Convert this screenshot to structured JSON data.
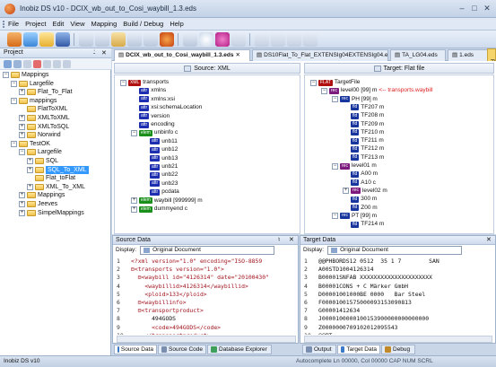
{
  "window": {
    "title": "Inobiz DS v10 - DCIX_wb_out_to_Cosi_waybill_1.3.eds"
  },
  "menu": [
    "File",
    "Project",
    "Edit",
    "View",
    "Mapping",
    "Build / Debug",
    "Help"
  ],
  "project_panel": {
    "title": "Project",
    "close": "✕",
    "pin": "⍘"
  },
  "tree": [
    {
      "depth": 0,
      "label": "Mappings",
      "exp": "−"
    },
    {
      "depth": 1,
      "label": "Largefile",
      "exp": "−"
    },
    {
      "depth": 2,
      "label": "Flat_To_Flat",
      "exp": "+"
    },
    {
      "depth": 1,
      "label": "mappings",
      "exp": "−"
    },
    {
      "depth": 2,
      "label": "FlatToXML",
      "exp": ""
    },
    {
      "depth": 2,
      "label": "XMLToXML",
      "exp": "+"
    },
    {
      "depth": 2,
      "label": "XMLToSQL",
      "exp": "+"
    },
    {
      "depth": 2,
      "label": "Norwind",
      "exp": "+"
    },
    {
      "depth": 1,
      "label": "TestOK",
      "exp": "−"
    },
    {
      "depth": 2,
      "label": "Largefile",
      "exp": "−"
    },
    {
      "depth": 3,
      "label": "SQL",
      "exp": "+"
    },
    {
      "depth": 3,
      "label": "SQL_To_XML",
      "exp": "+",
      "selected": true
    },
    {
      "depth": 3,
      "label": "Flat_toFlat",
      "exp": ""
    },
    {
      "depth": 3,
      "label": "XML_To_XML",
      "exp": "+"
    },
    {
      "depth": 2,
      "label": "Mappings",
      "exp": "+"
    },
    {
      "depth": 2,
      "label": "Jeeves",
      "exp": "+"
    },
    {
      "depth": 2,
      "label": "SimpelMappings",
      "exp": "+"
    }
  ],
  "doc_tabs": [
    {
      "label": "DCIX_wb_out_to_Cosi_waybill_1.3.eds",
      "active": true
    },
    {
      "label": "DS10Flat_To_Flat_EXTENSIg04EXTENSIg04.eds",
      "active": false
    },
    {
      "label": "TA_LG04.eds",
      "active": false
    },
    {
      "label": "1.eds",
      "active": false
    }
  ],
  "source_header": "Source: XML",
  "target_header": "Target: Flat file",
  "source_nodes": [
    {
      "depth": 0,
      "badge": "XML",
      "cls": "b-xml",
      "label": "transports",
      "exp": "−"
    },
    {
      "depth": 1,
      "badge": "attr",
      "cls": "b-attr",
      "label": "xmlns",
      "exp": ""
    },
    {
      "depth": 1,
      "badge": "attr",
      "cls": "b-attr",
      "label": "xmlns:xsi",
      "exp": ""
    },
    {
      "depth": 1,
      "badge": "attr",
      "cls": "b-attr",
      "label": "xsi:schemaLocation",
      "exp": ""
    },
    {
      "depth": 1,
      "badge": "attr",
      "cls": "b-attr",
      "label": "version",
      "exp": ""
    },
    {
      "depth": 1,
      "badge": "attr",
      "cls": "b-attr",
      "label": "encoding",
      "exp": ""
    },
    {
      "depth": 1,
      "badge": "elem",
      "cls": "b-green",
      "label": "unbinfo c",
      "exp": "−"
    },
    {
      "depth": 2,
      "badge": "attr",
      "cls": "b-attr",
      "label": "unb11",
      "exp": ""
    },
    {
      "depth": 2,
      "badge": "attr",
      "cls": "b-attr",
      "label": "unb12",
      "exp": ""
    },
    {
      "depth": 2,
      "badge": "attr",
      "cls": "b-attr",
      "label": "unb13",
      "exp": ""
    },
    {
      "depth": 2,
      "badge": "attr",
      "cls": "b-attr",
      "label": "unb21",
      "exp": ""
    },
    {
      "depth": 2,
      "badge": "attr",
      "cls": "b-attr",
      "label": "unb22",
      "exp": ""
    },
    {
      "depth": 2,
      "badge": "attr",
      "cls": "b-attr",
      "label": "unb23",
      "exp": ""
    },
    {
      "depth": 2,
      "badge": "attr",
      "cls": "b-attr",
      "label": "pcdata",
      "exp": ""
    },
    {
      "depth": 1,
      "badge": "elem",
      "cls": "b-green",
      "label": "waybill [999999] m",
      "exp": "+"
    },
    {
      "depth": 1,
      "badge": "elem",
      "cls": "b-green",
      "label": "dummyend c",
      "exp": "+"
    }
  ],
  "target_nodes": [
    {
      "depth": 0,
      "badge": "FLAT",
      "cls": "b-xml",
      "label": "TargetFile",
      "exp": "−",
      "note": ""
    },
    {
      "depth": 1,
      "badge": "rec",
      "cls": "b-purple",
      "label": "level00 [99] m",
      "exp": "−",
      "note": "<-- transports.waybill"
    },
    {
      "depth": 2,
      "badge": "rec",
      "cls": "b-blue",
      "label": "PH [99] m",
      "exp": "−",
      "note": ""
    },
    {
      "depth": 3,
      "badge": "fld",
      "cls": "b-blue",
      "label": "TF207 m",
      "exp": "",
      "note": ""
    },
    {
      "depth": 3,
      "badge": "fld",
      "cls": "b-blue",
      "label": "TF208 m",
      "exp": "",
      "note": ""
    },
    {
      "depth": 3,
      "badge": "fld",
      "cls": "b-blue",
      "label": "TF209 m",
      "exp": "",
      "note": ""
    },
    {
      "depth": 3,
      "badge": "fld",
      "cls": "b-blue",
      "label": "TF210 m",
      "exp": "",
      "note": ""
    },
    {
      "depth": 3,
      "badge": "fld",
      "cls": "b-blue",
      "label": "TF211 m",
      "exp": "",
      "note": ""
    },
    {
      "depth": 3,
      "badge": "fld",
      "cls": "b-blue",
      "label": "TF212 m",
      "exp": "",
      "note": ""
    },
    {
      "depth": 3,
      "badge": "fld",
      "cls": "b-blue",
      "label": "TF213 m",
      "exp": "",
      "note": ""
    },
    {
      "depth": 2,
      "badge": "rec",
      "cls": "b-purple",
      "label": "level01 m",
      "exp": "−",
      "note": ""
    },
    {
      "depth": 3,
      "badge": "fld",
      "cls": "b-blue",
      "label": "A00 m",
      "exp": "",
      "note": ""
    },
    {
      "depth": 3,
      "badge": "fld",
      "cls": "b-blue",
      "label": "A10 c",
      "exp": "",
      "note": ""
    },
    {
      "depth": 3,
      "badge": "rec",
      "cls": "b-purple",
      "label": "level02 m",
      "exp": "+",
      "note": ""
    },
    {
      "depth": 3,
      "badge": "fld",
      "cls": "b-blue",
      "label": "300 m",
      "exp": "",
      "note": ""
    },
    {
      "depth": 3,
      "badge": "fld",
      "cls": "b-blue",
      "label": "Z00 m",
      "exp": "",
      "note": ""
    },
    {
      "depth": 2,
      "badge": "rec",
      "cls": "b-blue",
      "label": "PT [99] m",
      "exp": "−",
      "note": ""
    },
    {
      "depth": 3,
      "badge": "fld",
      "cls": "b-blue",
      "label": "TF214 m",
      "exp": "",
      "note": ""
    }
  ],
  "source_data": {
    "title": "Source Data",
    "display_label": "Display:",
    "display_value": "Original Document",
    "lines": [
      {
        "n": "1",
        "text": "<?xml version=\"1.0\" encoding=\"ISO-8859"
      },
      {
        "n": "2",
        "text": "⊟<transports version=\"1.0\">"
      },
      {
        "n": "3",
        "text": "  ⊟<waybill id=\"4126314\" date=\"20100430\""
      },
      {
        "n": "4",
        "text": "    <waybillid>4126314</waybillid>"
      },
      {
        "n": "5",
        "text": "    <ploid>133</ploid>"
      },
      {
        "n": "6",
        "text": "  ⊟<waybillinfo>"
      },
      {
        "n": "7",
        "text": "  ⊟<transportproduct>"
      },
      {
        "n": "8",
        "text": "      494GODS"
      },
      {
        "n": "9",
        "text": "      <code>494GODS</code>"
      },
      {
        "n": "10",
        "text": "    </transportproduct>"
      }
    ]
  },
  "target_data": {
    "title": "Target Data",
    "display_label": "Display:",
    "display_value": "Original Document",
    "lines": [
      {
        "n": "1",
        "text": "@@PHBORDS12 0512  35 1 7        SAN"
      },
      {
        "n": "2",
        "text": "A00STD1004126314"
      },
      {
        "n": "3",
        "text": "B00001SNFAB XXXXXXXXXXXXXXXXXXXXX"
      },
      {
        "n": "4",
        "text": "B00001CONS + C Märker GmbH"
      },
      {
        "n": "5",
        "text": "D00001001000BE 0000   Bar Steel"
      },
      {
        "n": "6",
        "text": "F00001001575000093153090813"
      },
      {
        "n": "7",
        "text": "G00001412634"
      },
      {
        "n": "8",
        "text": "J0000100000100153900000000000000"
      },
      {
        "n": "9",
        "text": "Z0000000709102012095543"
      },
      {
        "n": "10",
        "text": "@@PT"
      }
    ]
  },
  "bottom_tabs_left": [
    {
      "label": "Source Data",
      "active": true,
      "color": "#3a78c8"
    },
    {
      "label": "Source Code",
      "active": false,
      "color": "#7a8fb0"
    },
    {
      "label": "Database Explorer",
      "active": false,
      "color": "#3ea05a"
    }
  ],
  "bottom_tabs_right": [
    {
      "label": "Output",
      "active": false,
      "color": "#7a8fb0"
    },
    {
      "label": "Target Data",
      "active": true,
      "color": "#3a78c8"
    },
    {
      "label": "Debug",
      "active": false,
      "color": "#c08a2a"
    }
  ],
  "status": {
    "left": "Inobiz DS v10",
    "right": "Autocomplete  Ln 00000, Col 00000  CAP  NUM  SCRL"
  },
  "find_strip": "Find"
}
